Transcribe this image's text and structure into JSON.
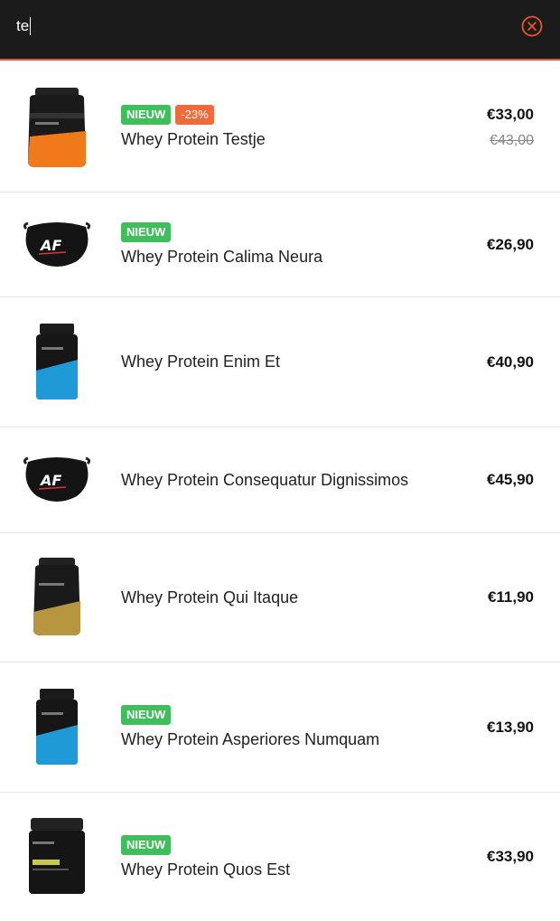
{
  "search": {
    "value": "te",
    "clear_icon": "close-circle-icon",
    "accent_color": "#e8552c"
  },
  "products": [
    {
      "name": "Whey Protein Testje",
      "price": "€33,00",
      "old_price": "€43,00",
      "badges": [
        "NIEUW",
        "-23%"
      ],
      "image": "tub-orange"
    },
    {
      "name": "Whey Protein Calima Neura",
      "price": "€26,90",
      "old_price": "",
      "badges": [
        "NIEUW"
      ],
      "image": "face-mask"
    },
    {
      "name": "Whey Protein Enim Et",
      "price": "€40,90",
      "old_price": "",
      "badges": [],
      "image": "bottle-blue"
    },
    {
      "name": "Whey Protein Consequatur Dignissimos",
      "price": "€45,90",
      "old_price": "",
      "badges": [],
      "image": "face-mask"
    },
    {
      "name": "Whey Protein Qui Itaque",
      "price": "€11,90",
      "old_price": "",
      "badges": [],
      "image": "tub-gold"
    },
    {
      "name": "Whey Protein Asperiores Numquam",
      "price": "€13,90",
      "old_price": "",
      "badges": [
        "NIEUW"
      ],
      "image": "bottle-blue"
    },
    {
      "name": "Whey Protein Quos Est",
      "price": "€33,90",
      "old_price": "",
      "badges": [
        "NIEUW"
      ],
      "image": "tub-yellow"
    }
  ],
  "colors": {
    "badge_new": "#3fbe5b",
    "badge_sale": "#f06a3a"
  }
}
